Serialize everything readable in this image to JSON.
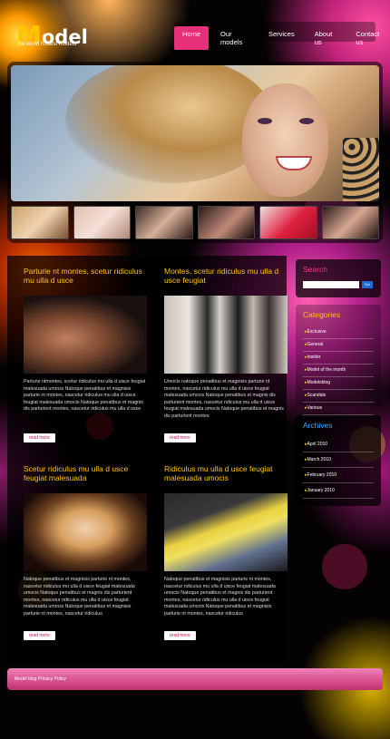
{
  "header": {
    "logo_initial": "M",
    "logo_rest": "odel",
    "tagline": "the world hottest models",
    "nav": [
      "Home",
      "Our models",
      "Services",
      "About us",
      "Contact us"
    ]
  },
  "posts": [
    {
      "title": "Parturie nt montes, scetur ridiculus mu ulla d usce",
      "text": "Parturie ntmontes, scetur ridiculus mu ulla d uisce feugiat malesuada umocis Natoque penatibus et magnisis parturie nt montes, nascetur ridiculus mu ulla d uisce feugiat malesuada umocis Natoque penatibus et magnis dis parturient montes, nascetur ridiculus mu ulla d usce",
      "button": "read more"
    },
    {
      "title": "Montes, scetur ridiculus mu ulla d usce feugiat",
      "text": "Umocis natoque penatibus et magnisis parturie nt montes, nascetur ridiculus mu ulla d uisce feugiat malesuada umocis Natoque penatibus et magnis dis parturient montes, nascetur ridiculus mu ulla d uisce feugiat malesuada umocis Natoque penatibus et magnis dis parturient montes",
      "button": "read more"
    },
    {
      "title": "Scetur ridiculus mu ulla d usce feugiat malesuada",
      "text": "Natoque penatibus et magnisis parturie nt montes, nascetur ridiculus mu ulla d uisce feugiat malesuada umocis Natoque penatibus et magnis dis parturient montes, nascetur ridiculus mu ulla d uisce feugiat malesuada umocis Natoque penatibus et magnisis parturie nt montes, nascetur ridiculus",
      "button": "read more"
    },
    {
      "title": "Ridiculus mu ulla d usce feugiat malesuada umocis",
      "text": "Natoque penatibus et magnisis parturie nt montes, nascetur ridiculus mu ulla d uisce feugiat malesuada umocis Natoque penatibus et magnis dis parturient montes, nascetur ridiculus mu ulla d uisce feugiat malesuada umocis Natoque penatibus et magnisis parturie nt montes, nascetur ridiculus",
      "button": "read more"
    }
  ],
  "sidebar": {
    "search_title": "Search",
    "search_button": "Go!",
    "categories_title": "Categories",
    "categories": [
      "Exclusive",
      "General",
      "Insider",
      "Model of the month",
      "Modelsblog",
      "Scandals",
      "Various"
    ],
    "archives_title": "Archives",
    "archives": [
      "April 2010",
      "March 2010",
      "February 2010",
      "January 2010"
    ]
  },
  "footer": {
    "text": "Model blog Privacy Policy"
  },
  "colors": {
    "accent": "#e8307a",
    "heading": "#ffc400",
    "search_heading": "#ff2c8a",
    "categories_heading": "#ffc400",
    "archives_heading": "#3aa8ff"
  }
}
